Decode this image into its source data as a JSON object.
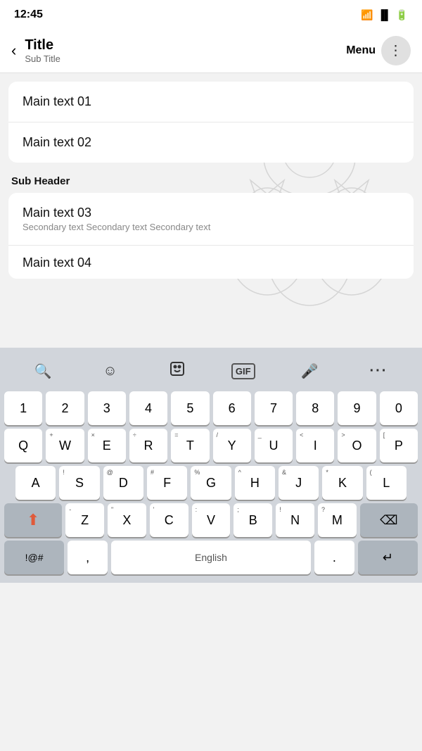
{
  "statusBar": {
    "time": "12:45",
    "wifiIcon": "wifi",
    "signalIcon": "signal",
    "batteryIcon": "battery"
  },
  "appBar": {
    "backLabel": "‹",
    "title": "Title",
    "subtitle": "Sub Title",
    "menuLabel": "Menu",
    "moreIcon": "⋮"
  },
  "content": {
    "subHeader": "Sub Header",
    "items": [
      {
        "main": "Main text 01",
        "secondary": ""
      },
      {
        "main": "Main text 02",
        "secondary": ""
      },
      {
        "main": "Main text 03",
        "secondary": "Secondary text Secondary text Secondary text"
      },
      {
        "main": "Main text 04",
        "secondary": ""
      }
    ]
  },
  "keyboard": {
    "toolbar": {
      "search": "🔍",
      "emoji": "☺",
      "sticker": "🎭",
      "gif": "GIF",
      "mic": "🎤",
      "more": "···"
    },
    "rows": {
      "numbers": [
        "1",
        "2",
        "3",
        "4",
        "5",
        "6",
        "7",
        "8",
        "9",
        "0"
      ],
      "row1": [
        {
          "label": "Q",
          "sub": ""
        },
        {
          "label": "W",
          "sub": "+"
        },
        {
          "label": "E",
          "sub": "×"
        },
        {
          "label": "R",
          "sub": "÷"
        },
        {
          "label": "T",
          "sub": "="
        },
        {
          "label": "Y",
          "sub": "/"
        },
        {
          "label": "U",
          "sub": "_"
        },
        {
          "label": "I",
          "sub": "<"
        },
        {
          "label": "O",
          "sub": ">"
        },
        {
          "label": "P",
          "sub": "["
        }
      ],
      "row2": [
        {
          "label": "A",
          "sub": ""
        },
        {
          "label": "S",
          "sub": "!"
        },
        {
          "label": "D",
          "sub": "@"
        },
        {
          "label": "F",
          "sub": "#"
        },
        {
          "label": "G",
          "sub": "%"
        },
        {
          "label": "H",
          "sub": "^"
        },
        {
          "label": "J",
          "sub": "&"
        },
        {
          "label": "K",
          "sub": "*"
        },
        {
          "label": "L",
          "sub": "("
        }
      ],
      "row3": [
        {
          "label": "Z",
          "sub": "-"
        },
        {
          "label": "X",
          "sub": "\""
        },
        {
          "label": "C",
          "sub": "'"
        },
        {
          "label": "V",
          "sub": ":"
        },
        {
          "label": "B",
          "sub": ";"
        },
        {
          "label": "N",
          "sub": "!"
        },
        {
          "label": "M",
          "sub": "?"
        }
      ],
      "bottomLeft": "!@#",
      "comma": ",",
      "space": "English",
      "period": ".",
      "enterIcon": "↵"
    }
  }
}
